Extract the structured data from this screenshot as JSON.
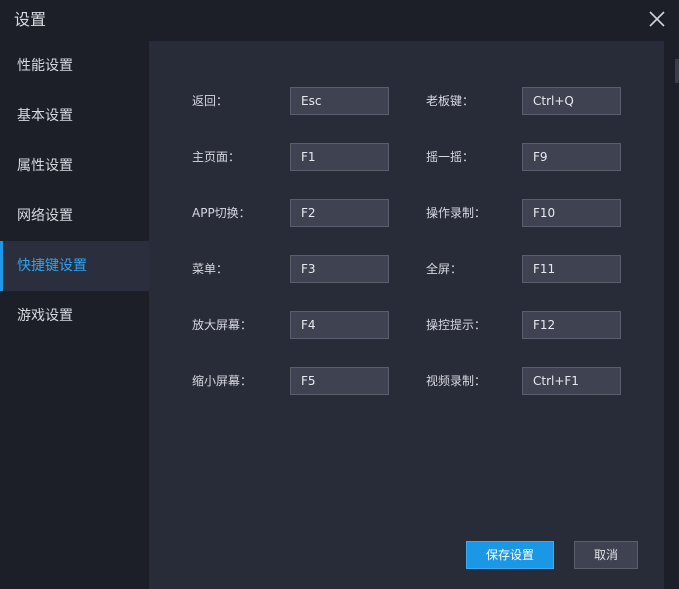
{
  "window": {
    "title": "设置"
  },
  "sidebar": {
    "items": [
      {
        "label": "性能设置"
      },
      {
        "label": "基本设置"
      },
      {
        "label": "属性设置"
      },
      {
        "label": "网络设置"
      },
      {
        "label": "快捷键设置",
        "active": true
      },
      {
        "label": "游戏设置"
      }
    ]
  },
  "shortcuts": {
    "left": [
      {
        "label": "返回：",
        "key": "Esc"
      },
      {
        "label": "主页面：",
        "key": "F1"
      },
      {
        "label": "APP切换：",
        "key": "F2"
      },
      {
        "label": "菜单：",
        "key": "F3"
      },
      {
        "label": "放大屏幕：",
        "key": "F4"
      },
      {
        "label": "缩小屏幕：",
        "key": "F5"
      }
    ],
    "right": [
      {
        "label": "老板键：",
        "key": "Ctrl+Q"
      },
      {
        "label": "摇一摇：",
        "key": "F9"
      },
      {
        "label": "操作录制：",
        "key": "F10"
      },
      {
        "label": "全屏：",
        "key": "F11"
      },
      {
        "label": "操控提示：",
        "key": "F12"
      },
      {
        "label": "视频录制：",
        "key": "Ctrl+F1"
      }
    ]
  },
  "footer": {
    "save_label": "保存设置",
    "cancel_label": "取消"
  },
  "colors": {
    "accent": "#1a98e6",
    "active_text": "#2ea3ee"
  },
  "icons": {
    "close": "close-icon"
  }
}
